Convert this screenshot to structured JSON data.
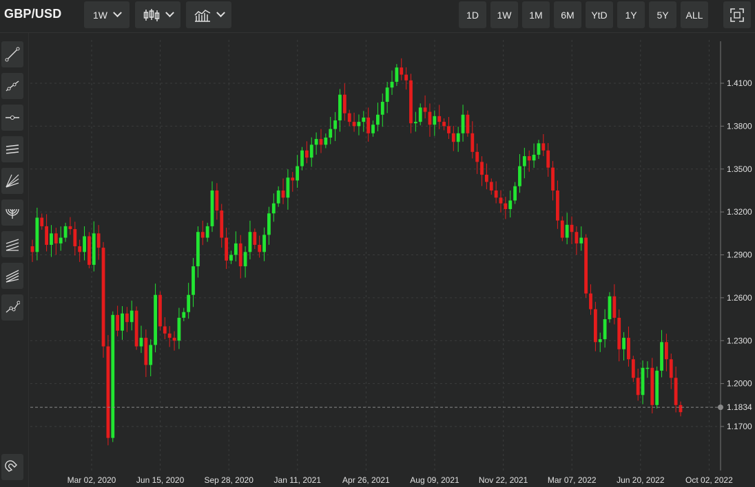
{
  "header": {
    "symbol": "GBP/USD",
    "interval_label": "1W",
    "ranges": [
      "1D",
      "1W",
      "1M",
      "6M",
      "YtD",
      "1Y",
      "5Y",
      "ALL"
    ],
    "icons": [
      "candlestick-chart-icon",
      "indicators-icon",
      "fullscreen-icon"
    ]
  },
  "sidebar": {
    "tools": [
      "trend-line-icon",
      "ray-icon",
      "horizontal-line-icon",
      "parallel-channel-icon",
      "fan-lines-icon",
      "fibonacci-arc-icon",
      "regression-channel-icon",
      "pitchfork-icon",
      "multi-point-line-icon"
    ],
    "magnet": "magnet-icon"
  },
  "colors": {
    "up": "#22e532",
    "down": "#e51c1c",
    "background": "#262727",
    "grid": "#3b3c3c",
    "axis_text": "#e0e0e0"
  },
  "chart_data": {
    "type": "candlestick",
    "interval": "1W",
    "last_price": 1.1834,
    "y_ticks": [
      1.41,
      1.38,
      1.35,
      1.32,
      1.29,
      1.26,
      1.23,
      1.2,
      1.17
    ],
    "y_tick_labels": [
      "1.4100",
      "1.3800",
      "1.3500",
      "1.3200",
      "1.2900",
      "1.2600",
      "1.2300",
      "1.2000",
      "1.1700"
    ],
    "last_price_label": "1.1834",
    "ylim": [
      1.145,
      1.445
    ],
    "x_ticks": [
      "Mar 02, 2020",
      "Jun 15, 2020",
      "Sep 28, 2020",
      "Jan 11, 2021",
      "Apr 26, 2021",
      "Aug 09, 2021",
      "Nov 22, 2021",
      "Mar 07, 2022",
      "Jun 20, 2022",
      "Oct 02, 2022"
    ],
    "grid": true,
    "closes": [
      1.292,
      1.316,
      1.31,
      1.297,
      1.305,
      1.298,
      1.302,
      1.31,
      1.308,
      1.296,
      1.292,
      1.303,
      1.283,
      1.305,
      1.295,
      1.226,
      1.162,
      1.248,
      1.237,
      1.249,
      1.243,
      1.251,
      1.226,
      1.232,
      1.213,
      1.227,
      1.262,
      1.24,
      1.235,
      1.232,
      1.23,
      1.246,
      1.25,
      1.262,
      1.282,
      1.306,
      1.302,
      1.31,
      1.335,
      1.321,
      1.302,
      1.286,
      1.29,
      1.298,
      1.282,
      1.292,
      1.306,
      1.297,
      1.292,
      1.304,
      1.319,
      1.326,
      1.335,
      1.33,
      1.344,
      1.342,
      1.352,
      1.363,
      1.358,
      1.367,
      1.371,
      1.367,
      1.372,
      1.378,
      1.384,
      1.402,
      1.389,
      1.383,
      1.38,
      1.383,
      1.386,
      1.375,
      1.381,
      1.388,
      1.397,
      1.407,
      1.411,
      1.421,
      1.416,
      1.412,
      1.382,
      1.383,
      1.393,
      1.39,
      1.381,
      1.387,
      1.383,
      1.38,
      1.375,
      1.369,
      1.375,
      1.388,
      1.375,
      1.362,
      1.355,
      1.346,
      1.341,
      1.335,
      1.33,
      1.326,
      1.322,
      1.328,
      1.338,
      1.352,
      1.359,
      1.356,
      1.36,
      1.368,
      1.363,
      1.351,
      1.335,
      1.314,
      1.302,
      1.311,
      1.306,
      1.298,
      1.302,
      1.263,
      1.252,
      1.229,
      1.231,
      1.245,
      1.261,
      1.246,
      1.224,
      1.232,
      1.217,
      1.204,
      1.192,
      1.211,
      1.211,
      1.185,
      1.209,
      1.229,
      1.217,
      1.204,
      1.185,
      1.18
    ]
  }
}
